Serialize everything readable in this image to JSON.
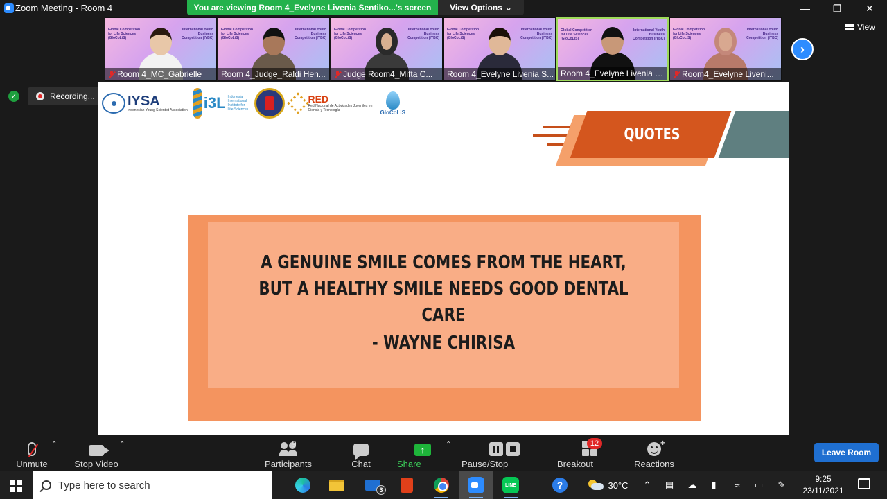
{
  "window": {
    "title": "Zoom Meeting - Room 4"
  },
  "share_banner": {
    "text": "You are viewing Room 4_Evelyne Livenia Sentiko...'s screen",
    "view_options": "View Options"
  },
  "video_strip": {
    "tiles": [
      {
        "name": "Room 4_MC_Gabrielle",
        "slide_left": "Global Competition for Life Sciences (GloCoLiS)",
        "slide_right": "International Youth Business Competition (IYBC)"
      },
      {
        "name": "Room 4_Judge_Raldi Hen...",
        "slide_left": "Global Competition for Life Sciences (GloCoLiS)",
        "slide_right": "International Youth Business Competition (IYBC)"
      },
      {
        "name": "Judge Room4_Mifta C...",
        "slide_left": "Global Competition for Life Sciences (GloCoLiS)",
        "slide_right": "International Youth Business Competition (IYBC)"
      },
      {
        "name": "Room 4_Evelyne Livenia S...",
        "slide_left": "Global Competition for Life Sciences (GloCoLiS)",
        "slide_right": "International Youth Business Competition (IYBC)"
      },
      {
        "name": "Room 4_Evelyne Livenia S...",
        "slide_left": "Global Competition for Life Sciences (GloCoLiS)",
        "slide_right": "International Youth Business Competition (IYBC)"
      },
      {
        "name": "Room4_Evelyne Liveni...",
        "slide_left": "Global Competition for Life Sciences (GloCoLiS)",
        "slide_right": "International Youth Business Competition (IYBC)"
      }
    ],
    "view_label": "View"
  },
  "recording": {
    "label": "Recording..."
  },
  "slide": {
    "logos": {
      "iysa": "IYSA",
      "iysa_sub": "Indonesian Young Scientist Association",
      "i3l": "i3L",
      "i3l_sub": "Indonesia International Institute for Life Sciences",
      "red": "RED",
      "red_sub": "Red Nacional de Actividades Juveniles en Ciencia y Tecnología",
      "glocolis": "GloCoLiS"
    },
    "title": "QUOTES",
    "quote_line1": "A GENUINE SMILE COMES FROM THE HEART,",
    "quote_line2": "BUT A HEALTHY SMILE NEEDS GOOD DENTAL CARE",
    "author": "- WAYNE CHIRISA"
  },
  "controls": {
    "unmute": "Unmute",
    "stop_video": "Stop Video",
    "participants": "Participants",
    "participants_count": "9",
    "chat": "Chat",
    "share_screen": "Share Screen",
    "recording": "Pause/Stop Recording",
    "breakout_rooms": "Breakout Rooms",
    "breakout_badge": "12",
    "reactions": "Reactions",
    "leave_room": "Leave Room"
  },
  "taskbar": {
    "search_placeholder": "Type here to search",
    "mail_badge": "3",
    "line_label": "LINE",
    "temperature": "30°C",
    "time": "9:25",
    "date": "23/11/2021"
  }
}
